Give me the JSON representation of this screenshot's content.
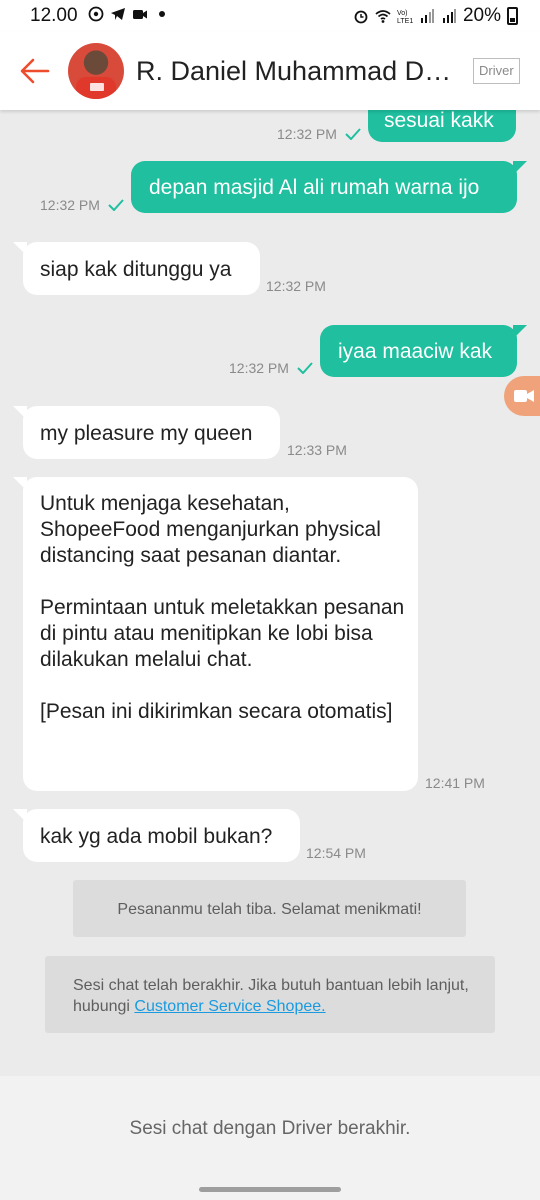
{
  "status_bar": {
    "time": "12.00",
    "battery": "20%",
    "icons": [
      "whatsapp-icon",
      "telegram-icon",
      "video-icon",
      "dot-icon",
      "alarm-icon",
      "wifi-icon",
      "volte-icon",
      "signal-icon",
      "signal-icon",
      "battery-icon"
    ]
  },
  "header": {
    "name": "R. Daniel Muhammad Daniel",
    "badge": "Driver",
    "back_icon": "arrow-left-icon",
    "accent_color": "#ee4d2d"
  },
  "messages": [
    {
      "direction": "out",
      "text": "sesuai kakk",
      "time": "12:32 PM",
      "read": true
    },
    {
      "direction": "out",
      "text": "depan masjid Al ali rumah warna ijo",
      "time": "12:32 PM",
      "read": true
    },
    {
      "direction": "in",
      "text": "siap kak ditunggu ya",
      "time": "12:32 PM"
    },
    {
      "direction": "out",
      "text": "iyaa maaciw kak",
      "time": "12:32 PM",
      "read": true
    },
    {
      "direction": "in",
      "text": "my pleasure my queen",
      "time": "12:33 PM"
    },
    {
      "direction": "in",
      "paragraphs": [
        "Untuk menjaga kesehatan, ShopeeFood menganjurkan physical distancing saat pesanan diantar.",
        "Permintaan untuk meletakkan pesanan di pintu atau menitipkan ke lobi bisa dilakukan melalui chat.",
        "[Pesan ini dikirimkan secara otomatis]"
      ],
      "time": "12:41 PM"
    },
    {
      "direction": "in",
      "text": "kak yg ada mobil bukan?",
      "time": "12:54 PM"
    }
  ],
  "system": {
    "arrived": "Pesananmu telah tiba. Selamat menikmati!",
    "ended_prefix": "Sesi chat telah berakhir. Jika butuh bantuan lebih lanjut, hubungi ",
    "ended_link": "Customer Service Shopee."
  },
  "footer": {
    "text": "Sesi chat dengan Driver berakhir."
  },
  "colors": {
    "outgoing_bubble": "#1fbf9f",
    "incoming_bubble": "#ffffff",
    "background": "#ebebeb",
    "link": "#1a9be0"
  }
}
